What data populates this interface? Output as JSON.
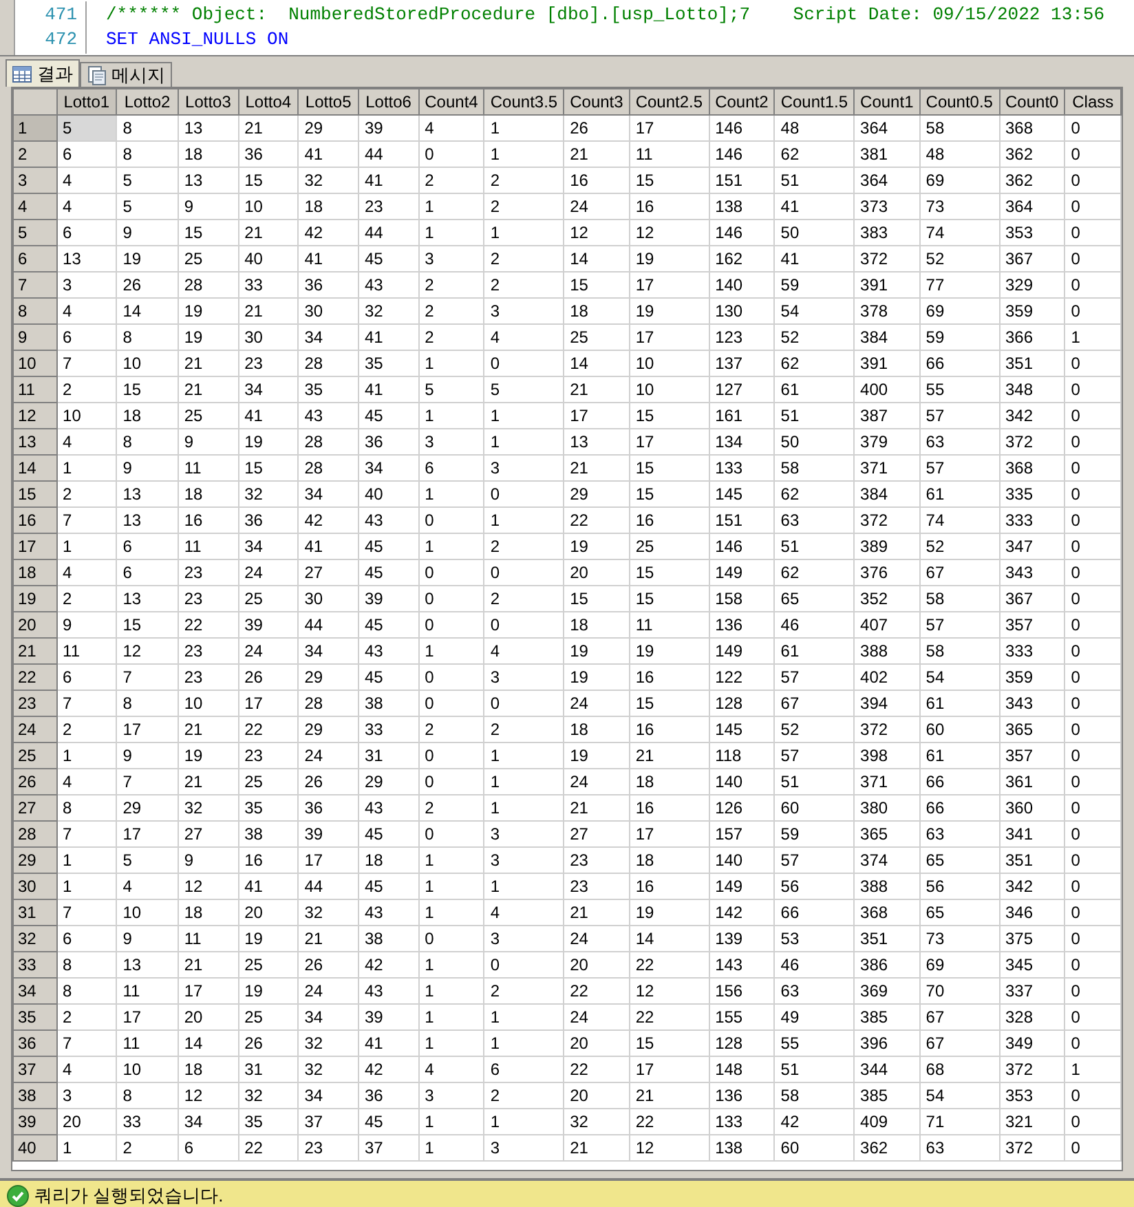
{
  "editor": {
    "lines": [
      {
        "number": "471",
        "kind": "comment",
        "text": "/****** Object:  NumberedStoredProcedure [dbo].[usp_Lotto];7    Script Date: 09/15/2022 13:56"
      },
      {
        "number": "472",
        "kind": "code",
        "text": "SET ANSI_NULLS ON"
      }
    ]
  },
  "tabs": [
    {
      "label": "결과",
      "selected": true
    },
    {
      "label": "메시지",
      "selected": false
    }
  ],
  "table": {
    "columns": [
      {
        "label": "Lotto1",
        "selected": true
      },
      {
        "label": "Lotto2",
        "selected": false
      },
      {
        "label": "Lotto3",
        "selected": false
      },
      {
        "label": "Lotto4",
        "selected": false
      },
      {
        "label": "Lotto5",
        "selected": false
      },
      {
        "label": "Lotto6",
        "selected": false
      },
      {
        "label": "Count4",
        "selected": false
      },
      {
        "label": "Count3.5",
        "selected": false
      },
      {
        "label": "Count3",
        "selected": false
      },
      {
        "label": "Count2.5",
        "selected": false
      },
      {
        "label": "Count2",
        "selected": false
      },
      {
        "label": "Count1.5",
        "selected": false
      },
      {
        "label": "Count1",
        "selected": false
      },
      {
        "label": "Count0.5",
        "selected": false
      },
      {
        "label": "Count0",
        "selected": false
      },
      {
        "label": "Class",
        "selected": false
      }
    ],
    "rows": [
      {
        "number": "1",
        "selected": true,
        "cells": [
          "5",
          "8",
          "13",
          "21",
          "29",
          "39",
          "4",
          "1",
          "26",
          "17",
          "146",
          "48",
          "364",
          "58",
          "368",
          "0"
        ]
      },
      {
        "number": "2",
        "selected": false,
        "cells": [
          "6",
          "8",
          "18",
          "36",
          "41",
          "44",
          "0",
          "1",
          "21",
          "11",
          "146",
          "62",
          "381",
          "48",
          "362",
          "0"
        ]
      },
      {
        "number": "3",
        "selected": false,
        "cells": [
          "4",
          "5",
          "13",
          "15",
          "32",
          "41",
          "2",
          "2",
          "16",
          "15",
          "151",
          "51",
          "364",
          "69",
          "362",
          "0"
        ]
      },
      {
        "number": "4",
        "selected": false,
        "cells": [
          "4",
          "5",
          "9",
          "10",
          "18",
          "23",
          "1",
          "2",
          "24",
          "16",
          "138",
          "41",
          "373",
          "73",
          "364",
          "0"
        ]
      },
      {
        "number": "5",
        "selected": false,
        "cells": [
          "6",
          "9",
          "15",
          "21",
          "42",
          "44",
          "1",
          "1",
          "12",
          "12",
          "146",
          "50",
          "383",
          "74",
          "353",
          "0"
        ]
      },
      {
        "number": "6",
        "selected": false,
        "cells": [
          "13",
          "19",
          "25",
          "40",
          "41",
          "45",
          "3",
          "2",
          "14",
          "19",
          "162",
          "41",
          "372",
          "52",
          "367",
          "0"
        ]
      },
      {
        "number": "7",
        "selected": false,
        "cells": [
          "3",
          "26",
          "28",
          "33",
          "36",
          "43",
          "2",
          "2",
          "15",
          "17",
          "140",
          "59",
          "391",
          "77",
          "329",
          "0"
        ]
      },
      {
        "number": "8",
        "selected": false,
        "cells": [
          "4",
          "14",
          "19",
          "21",
          "30",
          "32",
          "2",
          "3",
          "18",
          "19",
          "130",
          "54",
          "378",
          "69",
          "359",
          "0"
        ]
      },
      {
        "number": "9",
        "selected": false,
        "cells": [
          "6",
          "8",
          "19",
          "30",
          "34",
          "41",
          "2",
          "4",
          "25",
          "17",
          "123",
          "52",
          "384",
          "59",
          "366",
          "1"
        ]
      },
      {
        "number": "10",
        "selected": false,
        "cells": [
          "7",
          "10",
          "21",
          "23",
          "28",
          "35",
          "1",
          "0",
          "14",
          "10",
          "137",
          "62",
          "391",
          "66",
          "351",
          "0"
        ]
      },
      {
        "number": "11",
        "selected": false,
        "cells": [
          "2",
          "15",
          "21",
          "34",
          "35",
          "41",
          "5",
          "5",
          "21",
          "10",
          "127",
          "61",
          "400",
          "55",
          "348",
          "0"
        ]
      },
      {
        "number": "12",
        "selected": false,
        "cells": [
          "10",
          "18",
          "25",
          "41",
          "43",
          "45",
          "1",
          "1",
          "17",
          "15",
          "161",
          "51",
          "387",
          "57",
          "342",
          "0"
        ]
      },
      {
        "number": "13",
        "selected": false,
        "cells": [
          "4",
          "8",
          "9",
          "19",
          "28",
          "36",
          "3",
          "1",
          "13",
          "17",
          "134",
          "50",
          "379",
          "63",
          "372",
          "0"
        ]
      },
      {
        "number": "14",
        "selected": false,
        "cells": [
          "1",
          "9",
          "11",
          "15",
          "28",
          "34",
          "6",
          "3",
          "21",
          "15",
          "133",
          "58",
          "371",
          "57",
          "368",
          "0"
        ]
      },
      {
        "number": "15",
        "selected": false,
        "cells": [
          "2",
          "13",
          "18",
          "32",
          "34",
          "40",
          "1",
          "0",
          "29",
          "15",
          "145",
          "62",
          "384",
          "61",
          "335",
          "0"
        ]
      },
      {
        "number": "16",
        "selected": false,
        "cells": [
          "7",
          "13",
          "16",
          "36",
          "42",
          "43",
          "0",
          "1",
          "22",
          "16",
          "151",
          "63",
          "372",
          "74",
          "333",
          "0"
        ]
      },
      {
        "number": "17",
        "selected": false,
        "cells": [
          "1",
          "6",
          "11",
          "34",
          "41",
          "45",
          "1",
          "2",
          "19",
          "25",
          "146",
          "51",
          "389",
          "52",
          "347",
          "0"
        ]
      },
      {
        "number": "18",
        "selected": false,
        "cells": [
          "4",
          "6",
          "23",
          "24",
          "27",
          "45",
          "0",
          "0",
          "20",
          "15",
          "149",
          "62",
          "376",
          "67",
          "343",
          "0"
        ]
      },
      {
        "number": "19",
        "selected": false,
        "cells": [
          "2",
          "13",
          "23",
          "25",
          "30",
          "39",
          "0",
          "2",
          "15",
          "15",
          "158",
          "65",
          "352",
          "58",
          "367",
          "0"
        ]
      },
      {
        "number": "20",
        "selected": false,
        "cells": [
          "9",
          "15",
          "22",
          "39",
          "44",
          "45",
          "0",
          "0",
          "18",
          "11",
          "136",
          "46",
          "407",
          "57",
          "357",
          "0"
        ]
      },
      {
        "number": "21",
        "selected": false,
        "cells": [
          "11",
          "12",
          "23",
          "24",
          "34",
          "43",
          "1",
          "4",
          "19",
          "19",
          "149",
          "61",
          "388",
          "58",
          "333",
          "0"
        ]
      },
      {
        "number": "22",
        "selected": false,
        "cells": [
          "6",
          "7",
          "23",
          "26",
          "29",
          "45",
          "0",
          "3",
          "19",
          "16",
          "122",
          "57",
          "402",
          "54",
          "359",
          "0"
        ]
      },
      {
        "number": "23",
        "selected": false,
        "cells": [
          "7",
          "8",
          "10",
          "17",
          "28",
          "38",
          "0",
          "0",
          "24",
          "15",
          "128",
          "67",
          "394",
          "61",
          "343",
          "0"
        ]
      },
      {
        "number": "24",
        "selected": false,
        "cells": [
          "2",
          "17",
          "21",
          "22",
          "29",
          "33",
          "2",
          "2",
          "18",
          "16",
          "145",
          "52",
          "372",
          "60",
          "365",
          "0"
        ]
      },
      {
        "number": "25",
        "selected": false,
        "cells": [
          "1",
          "9",
          "19",
          "23",
          "24",
          "31",
          "0",
          "1",
          "19",
          "21",
          "118",
          "57",
          "398",
          "61",
          "357",
          "0"
        ]
      },
      {
        "number": "26",
        "selected": false,
        "cells": [
          "4",
          "7",
          "21",
          "25",
          "26",
          "29",
          "0",
          "1",
          "24",
          "18",
          "140",
          "51",
          "371",
          "66",
          "361",
          "0"
        ]
      },
      {
        "number": "27",
        "selected": false,
        "cells": [
          "8",
          "29",
          "32",
          "35",
          "36",
          "43",
          "2",
          "1",
          "21",
          "16",
          "126",
          "60",
          "380",
          "66",
          "360",
          "0"
        ]
      },
      {
        "number": "28",
        "selected": false,
        "cells": [
          "7",
          "17",
          "27",
          "38",
          "39",
          "45",
          "0",
          "3",
          "27",
          "17",
          "157",
          "59",
          "365",
          "63",
          "341",
          "0"
        ]
      },
      {
        "number": "29",
        "selected": false,
        "cells": [
          "1",
          "5",
          "9",
          "16",
          "17",
          "18",
          "1",
          "3",
          "23",
          "18",
          "140",
          "57",
          "374",
          "65",
          "351",
          "0"
        ]
      },
      {
        "number": "30",
        "selected": false,
        "cells": [
          "1",
          "4",
          "12",
          "41",
          "44",
          "45",
          "1",
          "1",
          "23",
          "16",
          "149",
          "56",
          "388",
          "56",
          "342",
          "0"
        ]
      },
      {
        "number": "31",
        "selected": false,
        "cells": [
          "7",
          "10",
          "18",
          "20",
          "32",
          "43",
          "1",
          "4",
          "21",
          "19",
          "142",
          "66",
          "368",
          "65",
          "346",
          "0"
        ]
      },
      {
        "number": "32",
        "selected": false,
        "cells": [
          "6",
          "9",
          "11",
          "19",
          "21",
          "38",
          "0",
          "3",
          "24",
          "14",
          "139",
          "53",
          "351",
          "73",
          "375",
          "0"
        ]
      },
      {
        "number": "33",
        "selected": false,
        "cells": [
          "8",
          "13",
          "21",
          "25",
          "26",
          "42",
          "1",
          "0",
          "20",
          "22",
          "143",
          "46",
          "386",
          "69",
          "345",
          "0"
        ]
      },
      {
        "number": "34",
        "selected": false,
        "cells": [
          "8",
          "11",
          "17",
          "19",
          "24",
          "43",
          "1",
          "2",
          "22",
          "12",
          "156",
          "63",
          "369",
          "70",
          "337",
          "0"
        ]
      },
      {
        "number": "35",
        "selected": false,
        "cells": [
          "2",
          "17",
          "20",
          "25",
          "34",
          "39",
          "1",
          "1",
          "24",
          "22",
          "155",
          "49",
          "385",
          "67",
          "328",
          "0"
        ]
      },
      {
        "number": "36",
        "selected": false,
        "cells": [
          "7",
          "11",
          "14",
          "26",
          "32",
          "41",
          "1",
          "1",
          "20",
          "15",
          "128",
          "55",
          "396",
          "67",
          "349",
          "0"
        ]
      },
      {
        "number": "37",
        "selected": false,
        "cells": [
          "4",
          "10",
          "18",
          "31",
          "32",
          "42",
          "4",
          "6",
          "22",
          "17",
          "148",
          "51",
          "344",
          "68",
          "372",
          "1"
        ]
      },
      {
        "number": "38",
        "selected": false,
        "cells": [
          "3",
          "8",
          "12",
          "32",
          "34",
          "36",
          "3",
          "2",
          "20",
          "21",
          "136",
          "58",
          "385",
          "54",
          "353",
          "0"
        ]
      },
      {
        "number": "39",
        "selected": false,
        "cells": [
          "20",
          "33",
          "34",
          "35",
          "37",
          "45",
          "1",
          "1",
          "32",
          "22",
          "133",
          "42",
          "409",
          "71",
          "321",
          "0"
        ]
      },
      {
        "number": "40",
        "selected": false,
        "cells": [
          "1",
          "2",
          "6",
          "22",
          "23",
          "37",
          "1",
          "3",
          "21",
          "12",
          "138",
          "60",
          "362",
          "63",
          "372",
          "0"
        ]
      }
    ]
  },
  "status_bar": {
    "message": "쿼리가 실행되었습니다."
  }
}
